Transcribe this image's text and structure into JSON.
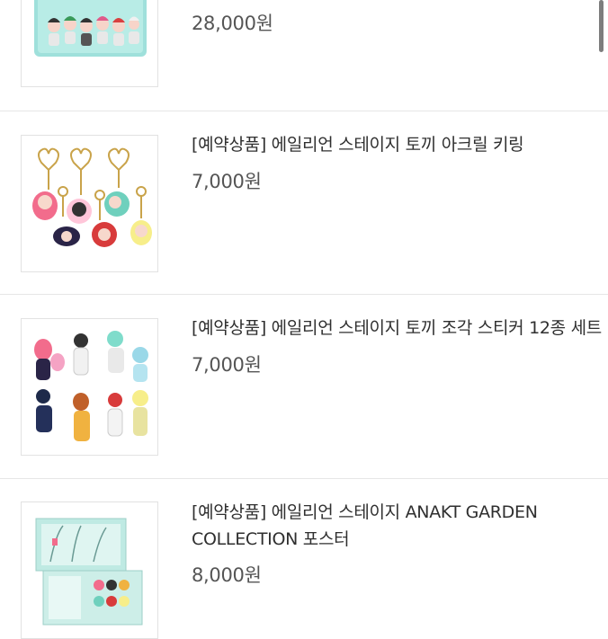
{
  "products": [
    {
      "title": "",
      "price": "28,000원"
    },
    {
      "title": "[예약상품] 에일리언 스테이지 토끼 아크릴 키링",
      "price": "7,000원"
    },
    {
      "title": "[예약상품] 에일리언 스테이지 토끼 조각 스티커 12종 세트",
      "price": "7,000원"
    },
    {
      "title": "[예약상품] 에일리언 스테이지 ANAKT GARDEN COLLECTION 포스터",
      "price": "8,000원"
    }
  ]
}
